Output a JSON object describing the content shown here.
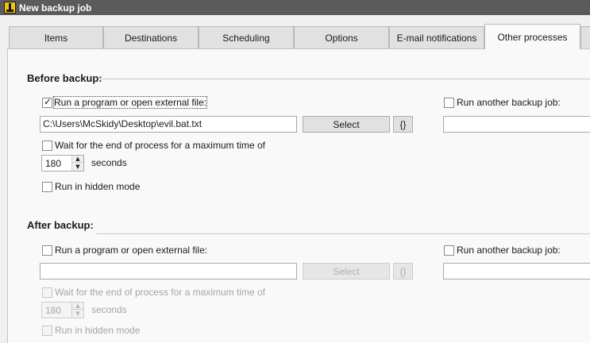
{
  "window": {
    "title": "New backup job"
  },
  "tabs": [
    {
      "label": "Items"
    },
    {
      "label": "Destinations"
    },
    {
      "label": "Scheduling"
    },
    {
      "label": "Options"
    },
    {
      "label": "E-mail notifications"
    },
    {
      "label": "Other processes",
      "active": true
    }
  ],
  "before": {
    "title": "Before backup:",
    "run_program": {
      "label": "Run a program or open external file:",
      "checked": true
    },
    "path": "C:\\Users\\McSkidy\\Desktop\\evil.bat.txt",
    "select_label": "Select",
    "vars_label": "{}",
    "run_another": {
      "label": "Run another backup job:",
      "checked": false,
      "value": ""
    },
    "wait": {
      "label": "Wait for the end of process for a maximum time of",
      "checked": false
    },
    "timeout": "180",
    "seconds_label": "seconds",
    "hidden": {
      "label": "Run in hidden mode",
      "checked": false
    }
  },
  "after": {
    "title": "After backup:",
    "run_program": {
      "label": "Run a program or open external file:",
      "checked": false
    },
    "path": "",
    "select_label": "Select",
    "vars_label": "{}",
    "run_another": {
      "label": "Run another backup job:",
      "checked": false,
      "value": ""
    },
    "wait": {
      "label": "Wait for the end of process for a maximum time of",
      "checked": false
    },
    "timeout": "180",
    "seconds_label": "seconds",
    "hidden": {
      "label": "Run in hidden mode",
      "checked": false
    }
  }
}
